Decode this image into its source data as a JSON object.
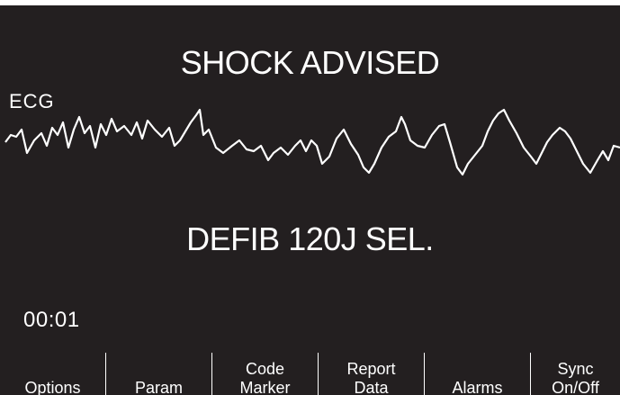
{
  "display": {
    "headline": "SHOCK ADVISED",
    "status_message": "DEFIB 120J SEL.",
    "waveform_label": "ECG",
    "elapsed_time": "00:01"
  },
  "softkeys": [
    {
      "label": "Options"
    },
    {
      "label": "Param"
    },
    {
      "label": "Code\nMarker"
    },
    {
      "label": "Report\nData"
    },
    {
      "label": "Alarms"
    },
    {
      "label": "Sync\nOn/Off"
    }
  ],
  "colors": {
    "background": "#231f20",
    "foreground": "#ffffff"
  }
}
